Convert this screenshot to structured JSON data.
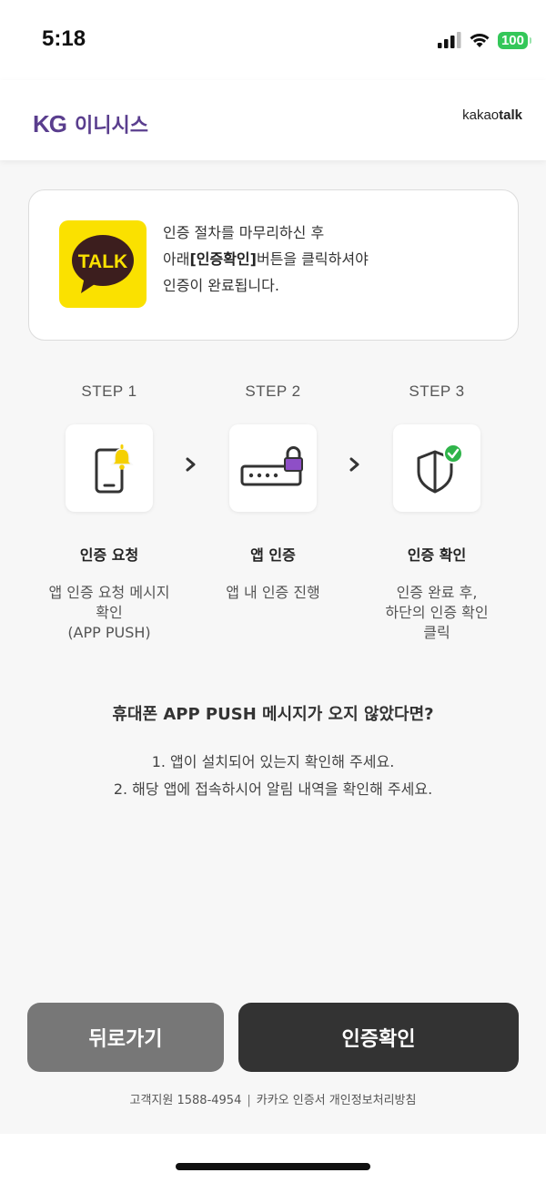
{
  "status_bar": {
    "time": "5:18",
    "battery": "100"
  },
  "header": {
    "brand_kg": "KG",
    "brand_name": "이니시스",
    "kakao_light": "kakao",
    "kakao_bold": "talk"
  },
  "info_card": {
    "icon_text": "TALK",
    "line1": "인증 절차를 마무리하신 후",
    "line2_prefix": "아래",
    "line2_bold": "[인증확인]",
    "line2_suffix": "버튼을 클릭하셔야",
    "line3": "인증이 완료됩니다."
  },
  "steps": [
    {
      "label": "STEP 1",
      "title": "인증 요청",
      "desc": [
        "앱 인증 요청 메시지",
        "확인",
        "(APP PUSH)"
      ],
      "icon": "phone-bell-icon"
    },
    {
      "label": "STEP 2",
      "title": "앱 인증",
      "desc": [
        "앱 내 인증 진행"
      ],
      "icon": "password-lock-icon"
    },
    {
      "label": "STEP 3",
      "title": "인증 확인",
      "desc": [
        "인증 완료 후,",
        "하단의 인증 확인",
        "클릭"
      ],
      "icon": "shield-check-icon"
    }
  ],
  "help": {
    "title": "휴대폰 APP PUSH 메시지가 오지 않았다면?",
    "lines": [
      "1. 앱이 설치되어 있는지 확인해 주세요.",
      "2. 해당 앱에 접속하시어 알림 내역을 확인해 주세요."
    ]
  },
  "buttons": {
    "back": "뒤로가기",
    "confirm": "인증확인"
  },
  "footer": {
    "support": "고객지원 1588-4954",
    "separator": "|",
    "kakao_cert": "카카오 인증서",
    "privacy": "개인정보처리방침"
  },
  "colors": {
    "brand": "#5a3e8e",
    "kakao_yellow": "#fae100",
    "back_button": "#777777",
    "confirm_button": "#333333",
    "status_green": "#34c759",
    "accent_bell": "#f5d000",
    "accent_lock": "#8e4fc7",
    "accent_check": "#2fb44a"
  }
}
